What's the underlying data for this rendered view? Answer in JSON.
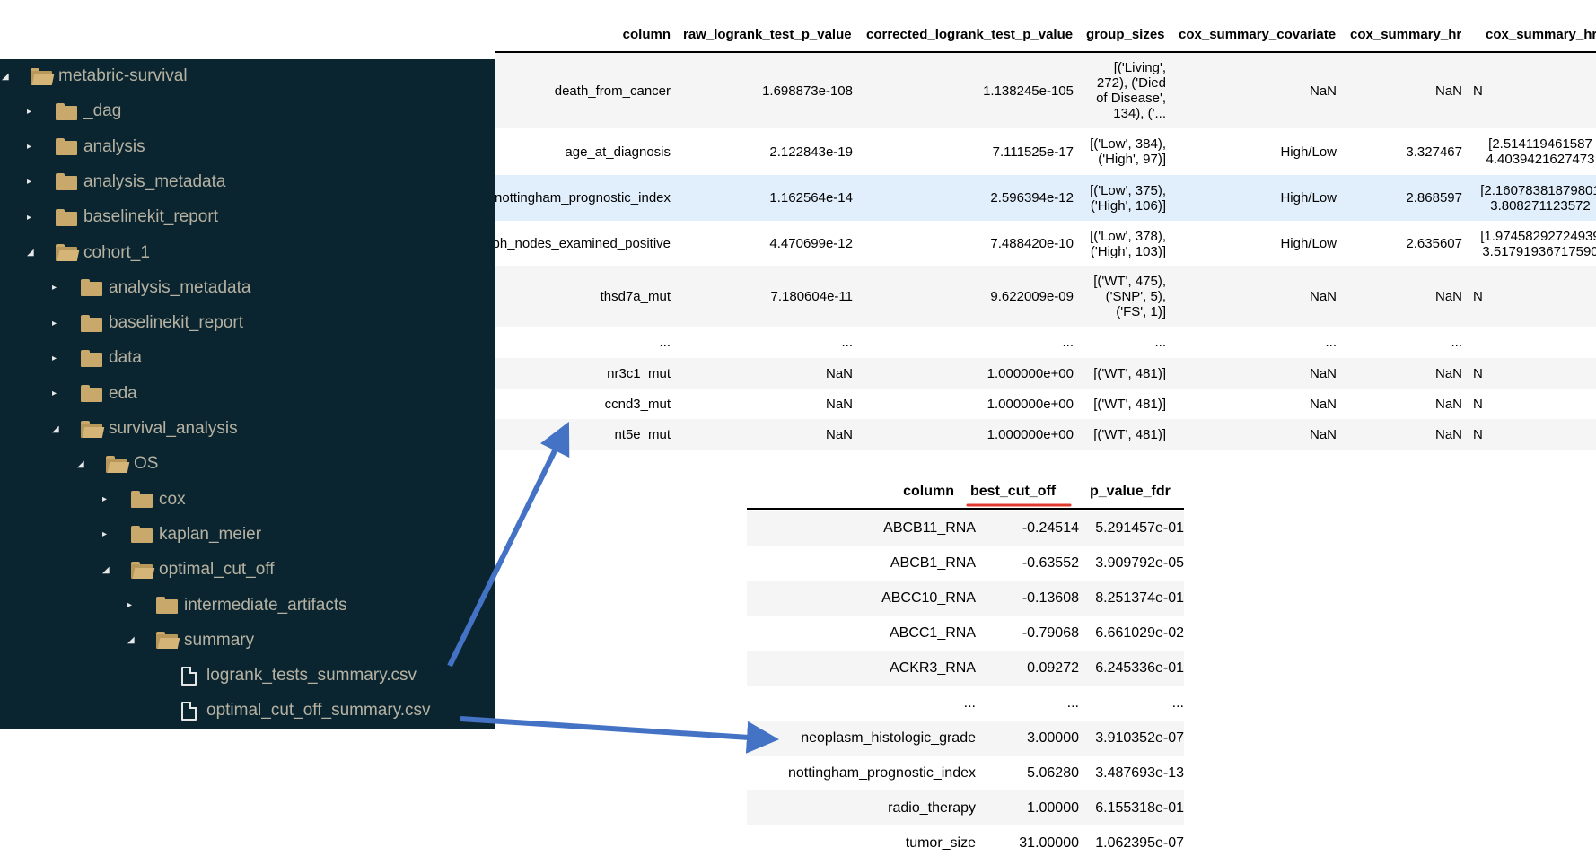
{
  "file_tree": [
    {
      "label": "metabric-survival",
      "level": 0,
      "type": "folder",
      "expanded": true
    },
    {
      "label": "_dag",
      "level": 1,
      "type": "folder",
      "expanded": false
    },
    {
      "label": "analysis",
      "level": 1,
      "type": "folder",
      "expanded": false
    },
    {
      "label": "analysis_metadata",
      "level": 1,
      "type": "folder",
      "expanded": false
    },
    {
      "label": "baselinekit_report",
      "level": 1,
      "type": "folder",
      "expanded": false
    },
    {
      "label": "cohort_1",
      "level": 1,
      "type": "folder",
      "expanded": true
    },
    {
      "label": "analysis_metadata",
      "level": 2,
      "type": "folder",
      "expanded": false
    },
    {
      "label": "baselinekit_report",
      "level": 2,
      "type": "folder",
      "expanded": false
    },
    {
      "label": "data",
      "level": 2,
      "type": "folder",
      "expanded": false
    },
    {
      "label": "eda",
      "level": 2,
      "type": "folder",
      "expanded": false
    },
    {
      "label": "survival_analysis",
      "level": 2,
      "type": "folder",
      "expanded": true
    },
    {
      "label": "OS",
      "level": 3,
      "type": "folder",
      "expanded": true
    },
    {
      "label": "cox",
      "level": 4,
      "type": "folder",
      "expanded": false
    },
    {
      "label": "kaplan_meier",
      "level": 4,
      "type": "folder",
      "expanded": false
    },
    {
      "label": "optimal_cut_off",
      "level": 4,
      "type": "folder",
      "expanded": true
    },
    {
      "label": "intermediate_artifacts",
      "level": 5,
      "type": "folder",
      "expanded": false
    },
    {
      "label": "summary",
      "level": 5,
      "type": "folder",
      "expanded": true
    },
    {
      "label": "logrank_tests_summary.csv",
      "level": 6,
      "type": "file"
    },
    {
      "label": "optimal_cut_off_summary.csv",
      "level": 6,
      "type": "file"
    }
  ],
  "logrank_table": {
    "headers": [
      "column",
      "raw_logrank_test_p_value",
      "corrected_logrank_test_p_value",
      "group_sizes",
      "cox_summary_covariate",
      "cox_summary_hr",
      "cox_summary_hr"
    ],
    "rows": [
      {
        "column": "death_from_cancer",
        "raw": "1.698873e-108",
        "corrected": "1.138245e-105",
        "group_sizes": "[('Living', 272), ('Died of Disease', 134), ('...",
        "covariate": "NaN",
        "hr": "NaN",
        "ci": "N"
      },
      {
        "column": "age_at_diagnosis",
        "raw": "2.122843e-19",
        "corrected": "7.111525e-17",
        "group_sizes": "[('Low', 384), ('High', 97)]",
        "covariate": "High/Low",
        "hr": "3.327467",
        "ci": "[2.514119461587 4.4039421627473"
      },
      {
        "column": "nottingham_prognostic_index",
        "raw": "1.162564e-14",
        "corrected": "2.596394e-12",
        "group_sizes": "[('Low', 375), ('High', 106)]",
        "covariate": "High/Low",
        "hr": "2.868597",
        "ci": "[2.16078381879801 3.808271123572"
      },
      {
        "column": "lymph_nodes_examined_positive",
        "raw": "4.470699e-12",
        "corrected": "7.488420e-10",
        "group_sizes": "[('Low', 378), ('High', 103)]",
        "covariate": "High/Low",
        "hr": "2.635607",
        "ci": "[1.97458292724939 3.51791936717590"
      },
      {
        "column": "thsd7a_mut",
        "raw": "7.180604e-11",
        "corrected": "9.622009e-09",
        "group_sizes": "[('WT', 475), ('SNP', 5), ('FS', 1)]",
        "covariate": "NaN",
        "hr": "NaN",
        "ci": "N"
      },
      {
        "column": "...",
        "raw": "...",
        "corrected": "...",
        "group_sizes": "...",
        "covariate": "...",
        "hr": "...",
        "ci": ""
      },
      {
        "column": "nr3c1_mut",
        "raw": "NaN",
        "corrected": "1.000000e+00",
        "group_sizes": "[('WT', 481)]",
        "covariate": "NaN",
        "hr": "NaN",
        "ci": "N"
      },
      {
        "column": "ccnd3_mut",
        "raw": "NaN",
        "corrected": "1.000000e+00",
        "group_sizes": "[('WT', 481)]",
        "covariate": "NaN",
        "hr": "NaN",
        "ci": "N"
      },
      {
        "column": "nt5e_mut",
        "raw": "NaN",
        "corrected": "1.000000e+00",
        "group_sizes": "[('WT', 481)]",
        "covariate": "NaN",
        "hr": "NaN",
        "ci": "N"
      }
    ]
  },
  "cutoff_table": {
    "headers": [
      "column",
      "best_cut_off",
      "p_value_fdr"
    ],
    "rows": [
      {
        "column": "ABCB11_RNA",
        "cut": "-0.24514",
        "p": "5.291457e-01"
      },
      {
        "column": "ABCB1_RNA",
        "cut": "-0.63552",
        "p": "3.909792e-05"
      },
      {
        "column": "ABCC10_RNA",
        "cut": "-0.13608",
        "p": "8.251374e-01"
      },
      {
        "column": "ABCC1_RNA",
        "cut": "-0.79068",
        "p": "6.661029e-02"
      },
      {
        "column": "ACKR3_RNA",
        "cut": "0.09272",
        "p": "6.245336e-01"
      },
      {
        "column": "...",
        "cut": "...",
        "p": "..."
      },
      {
        "column": "neoplasm_histologic_grade",
        "cut": "3.00000",
        "p": "3.910352e-07"
      },
      {
        "column": "nottingham_prognostic_index",
        "cut": "5.06280",
        "p": "3.487693e-13"
      },
      {
        "column": "radio_therapy",
        "cut": "1.00000",
        "p": "6.155318e-01"
      },
      {
        "column": "tumor_size",
        "cut": "31.00000",
        "p": "1.062395e-07"
      }
    ]
  },
  "colors": {
    "tree_bg": "#0b2530",
    "tree_text": "#b6b2a2",
    "folder": "#c8a86b",
    "arrow": "#4472c4",
    "underline": "#e03a2f",
    "row_highlight": "#e1effc",
    "row_stripe": "#f5f5f5"
  }
}
